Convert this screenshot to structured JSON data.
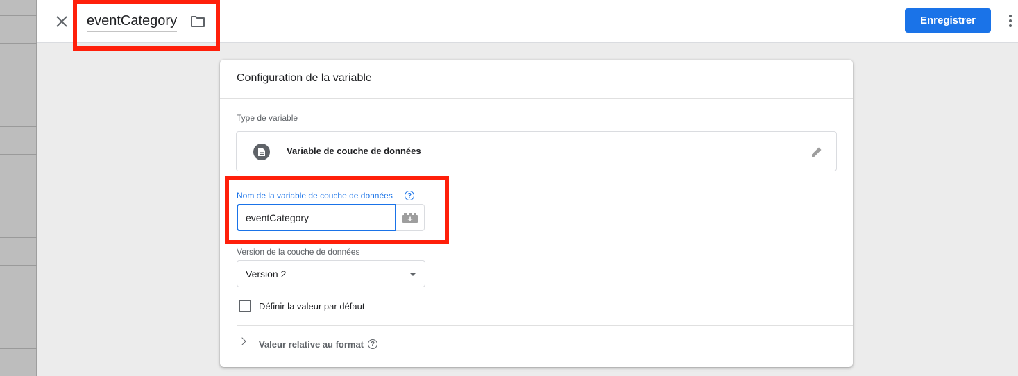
{
  "header": {
    "title": "eventCategory",
    "save_label": "Enregistrer"
  },
  "card": {
    "title": "Configuration de la variable",
    "type_section_label": "Type de variable",
    "variable_type": "Variable de couche de données",
    "name_field": {
      "label": "Nom de la variable de couche de données",
      "value": "eventCategory"
    },
    "version_field": {
      "label": "Version de la couche de données",
      "selected": "Version 2"
    },
    "default_checkbox": {
      "label": "Définir la valeur par défaut",
      "checked": false
    },
    "format_section": {
      "label": "Valeur relative au format"
    }
  },
  "icons": {
    "close": "close-icon",
    "folder": "folder-icon",
    "more": "more-vert-icon",
    "type": "document-icon",
    "edit": "pencil-icon",
    "help": "help-icon",
    "variable_picker": "brick-add-icon",
    "dropdown": "dropdown-arrow-icon",
    "expand": "chevron-right-icon"
  },
  "colors": {
    "accent": "#1a73e8",
    "highlight": "#ff1f0a"
  }
}
